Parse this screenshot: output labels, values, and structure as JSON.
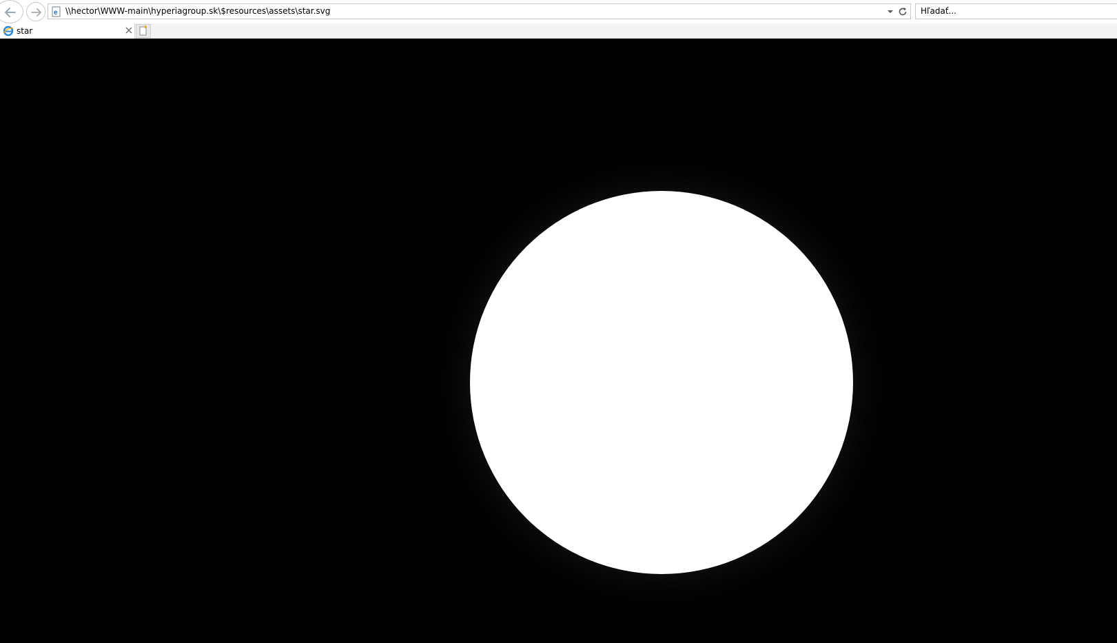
{
  "browser": {
    "address": "\\\\hector\\WWW-main\\hyperiagroup.sk\\$resources\\assets\\star.svg",
    "search_placeholder": "Hľadať...",
    "tabs": [
      {
        "label": "star"
      }
    ]
  },
  "icons": {
    "back": "back-arrow-icon",
    "forward": "forward-arrow-icon",
    "page": "ie-page-icon",
    "dropdown": "chevron-down-icon",
    "refresh": "refresh-icon",
    "tab": "ie-logo-icon",
    "close": "close-icon",
    "new_tab": "new-tab-icon"
  },
  "colors": {
    "page_background": "#000000",
    "star_fill": "#ffffff"
  }
}
